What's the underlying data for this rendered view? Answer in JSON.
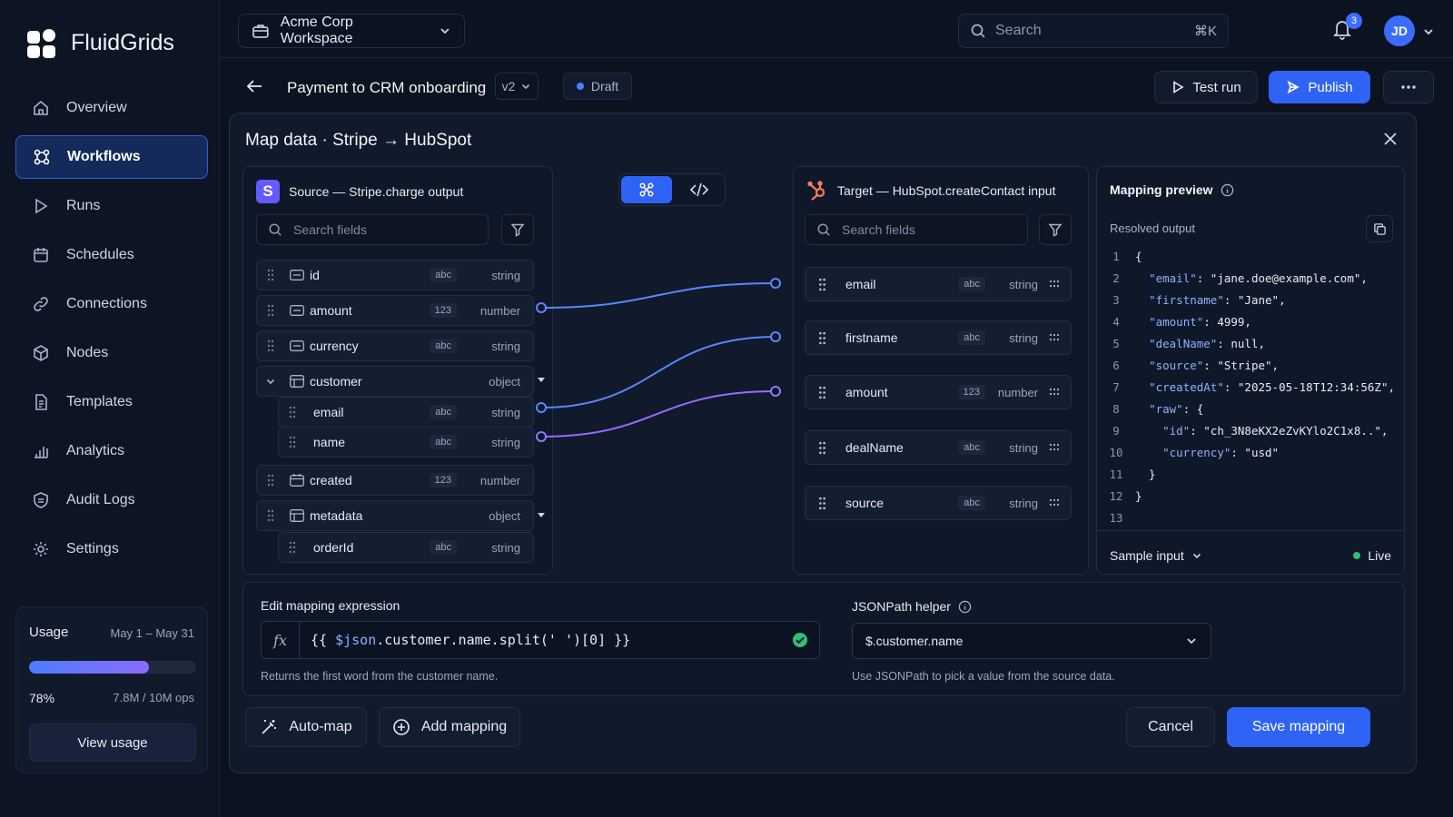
{
  "app": {
    "name": "FluidGrids"
  },
  "sidebar": {
    "items": [
      {
        "label": "Overview",
        "icon": "home-icon"
      },
      {
        "label": "Workflows",
        "icon": "workflows-icon",
        "active": true
      },
      {
        "label": "Runs",
        "icon": "play-icon"
      },
      {
        "label": "Schedules",
        "icon": "calendar-icon"
      },
      {
        "label": "Connections",
        "icon": "link-icon"
      },
      {
        "label": "Nodes",
        "icon": "cube-icon"
      },
      {
        "label": "Templates",
        "icon": "document-icon"
      },
      {
        "label": "Analytics",
        "icon": "bar-chart-icon"
      },
      {
        "label": "Audit Logs",
        "icon": "shield-icon"
      },
      {
        "label": "Settings",
        "icon": "gear-icon"
      }
    ]
  },
  "usage": {
    "title": "Usage",
    "range": "May 1 – May 31",
    "percent_label": "78%",
    "percent": 0.78,
    "ops": "7.8M / 10M ops",
    "view_button": "View usage"
  },
  "topbar": {
    "workspace": "Acme Corp Workspace",
    "search_placeholder": "Search",
    "search_shortcut": "⌘K",
    "notification_count": "3",
    "avatar_initials": "JD"
  },
  "workflow": {
    "title": "Payment to CRM onboarding",
    "version": "v2",
    "status": "Draft",
    "test_run": "Test run",
    "publish": "Publish"
  },
  "modal": {
    "title": "Map data · Stripe → HubSpot",
    "source": {
      "title": "Source — Stripe.charge output",
      "logo_letter": "S",
      "search_placeholder": "Search fields",
      "fields": [
        {
          "name": "id",
          "chip": "abc",
          "type": "string"
        },
        {
          "name": "amount",
          "chip": "123",
          "type": "number"
        },
        {
          "name": "currency",
          "chip": "abc",
          "type": "string"
        },
        {
          "name": "customer",
          "chip": "",
          "type": "object"
        },
        {
          "name": "email",
          "chip": "abc",
          "type": "string"
        },
        {
          "name": "name",
          "chip": "abc",
          "type": "string"
        },
        {
          "name": "created",
          "chip": "123",
          "type": "number"
        },
        {
          "name": "metadata",
          "chip": "",
          "type": "object"
        },
        {
          "name": "orderId",
          "chip": "abc",
          "type": "string"
        }
      ]
    },
    "target": {
      "title": "Target — HubSpot.createContact input",
      "search_placeholder": "Search fields",
      "fields": [
        {
          "name": "email",
          "chip": "abc",
          "type": "string"
        },
        {
          "name": "firstname",
          "chip": "abc",
          "type": "string"
        },
        {
          "name": "amount",
          "chip": "123",
          "type": "number"
        },
        {
          "name": "dealName",
          "chip": "abc",
          "type": "string"
        },
        {
          "name": "source",
          "chip": "abc",
          "type": "string"
        }
      ]
    },
    "preview": {
      "title": "Mapping preview",
      "resolved_label": "Resolved output",
      "lines": [
        "{",
        "  \"email\": \"jane.doe@example.com\",",
        "  \"firstname\": \"Jane\",",
        "  \"amount\": 4999,",
        "  \"dealName\": null,",
        "  \"source\": \"Stripe\",",
        "  \"createdAt\": \"2025-05-18T12:34:56Z\",",
        "  \"raw\": {",
        "    \"id\": \"ch_3N8eKX2eZvKYlo2C1x8..\",",
        "    \"currency\": \"usd\"",
        "  }",
        "}",
        ""
      ],
      "sample_input": "Sample input",
      "live": "Live"
    },
    "expression": {
      "label": "Edit mapping expression",
      "fx": "fx",
      "prefix": "{{ ",
      "var": "$json",
      "path": ".customer.name.split(' ')[0] }}",
      "help": "Returns the first word from the customer name."
    },
    "jsonpath": {
      "label": "JSONPath helper",
      "value": "$.customer.name",
      "help": "Use JSONPath to pick a value from the source data."
    },
    "footer": {
      "auto_map": "Auto-map",
      "add_mapping": "Add mapping",
      "cancel": "Cancel",
      "save": "Save mapping"
    }
  },
  "colors": {
    "accent": "#2f63f5",
    "active_nav": "#132a5a",
    "link_blue": "#5a86ff",
    "link_violet": "#9a6cff",
    "draft_dot": "#4f7cff",
    "live_dot": "#2fbf71",
    "ok_check": "#2fbf71",
    "hubspot": "#ff7a59",
    "stripe": "#635bff"
  }
}
